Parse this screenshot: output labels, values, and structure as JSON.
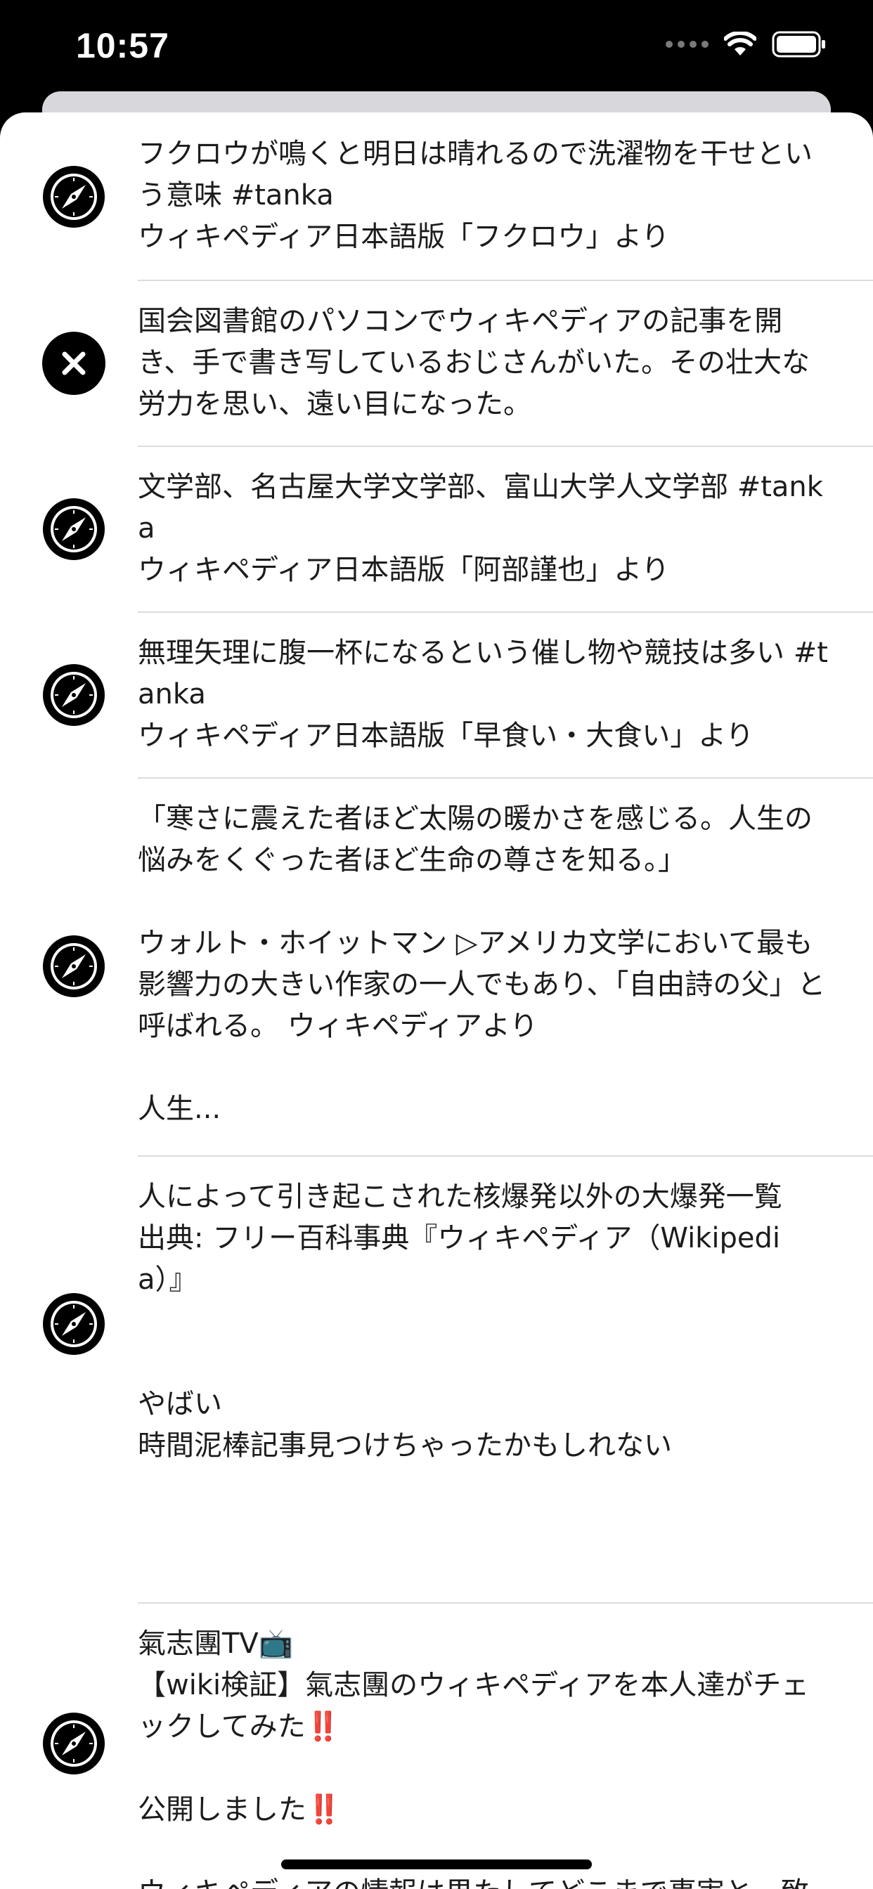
{
  "status_bar": {
    "time": "10:57"
  },
  "list": {
    "items": [
      {
        "icon": "safari-compass-icon",
        "text": "フクロウが鳴くと明日は晴れるので洗濯物を干せという意味 #tanka\nウィキペディア日本語版「フクロウ」より"
      },
      {
        "icon": "close-circle-icon",
        "text": "国会図書館のパソコンでウィキペディアの記事を開き、手で書き写しているおじさんがいた。その壮大な労力を思い、遠い目になった。"
      },
      {
        "icon": "safari-compass-icon",
        "text": "文学部、名古屋大学文学部、富山大学人文学部 #tanka\nウィキペディア日本語版「阿部謹也」より"
      },
      {
        "icon": "safari-compass-icon",
        "text": "無理矢理に腹一杯になるという催し物や競技は多い #tanka\nウィキペディア日本語版「早食い・大食い」より"
      },
      {
        "icon": "safari-compass-icon",
        "text": "「寒さに震えた者ほど太陽の暖かさを感じる。人生の悩みをくぐった者ほど生命の尊さを知る。」\n\nウォルト・ホイットマン ▷アメリカ文学において最も影響力の大きい作家の一人でもあり、「自由詩の父」と呼ばれる。 ウィキペディアより\n\n人生..."
      },
      {
        "icon": "safari-compass-icon",
        "text": "人によって引き起こされた核爆発以外の大爆発一覧\n出典: フリー百科事典『ウィキペディア（Wikipedia）』\n\n\nやばい\n時間泥棒記事見つけちゃったかもしれない"
      },
      {
        "icon": "safari-compass-icon",
        "text": "氣志團TV📺\n【wiki検証】氣志團のウィキペディアを本人達がチェックしてみた‼️\n\n公開しました‼️\n\nウィキペディアの情報は果たしてどこまで事実と一致しているのか⁉️メンバー自身が検証していきます‼️"
      }
    ]
  }
}
